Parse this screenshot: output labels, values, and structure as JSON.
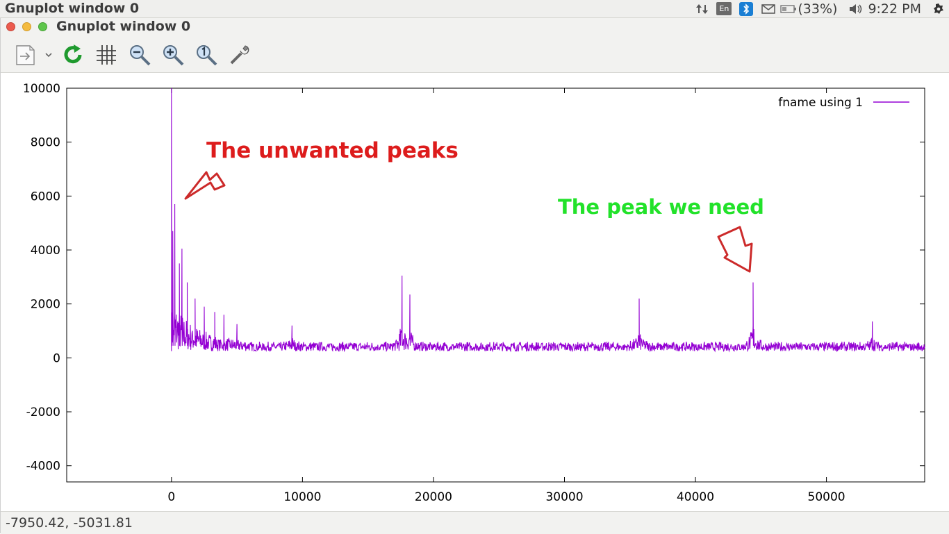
{
  "system_bar": {
    "app_title": "Gnuplot window 0",
    "keyboard_layout": "En",
    "battery_percent": "(33%)",
    "clock": "9:22 PM",
    "icons": [
      "network-icon",
      "keyboard-icon",
      "bluetooth-icon",
      "mail-icon",
      "battery-icon",
      "volume-icon",
      "gear-icon"
    ]
  },
  "window": {
    "title": "Gnuplot window 0",
    "toolbar": {
      "items": [
        "export-icon",
        "dropdown-arrow-icon",
        "replot-icon",
        "grid-icon",
        "zoom-out-icon",
        "zoom-in-icon",
        "zoom-reset-icon",
        "settings-wrench-icon"
      ]
    }
  },
  "chart_data": {
    "type": "line",
    "title": "",
    "xlabel": "",
    "ylabel": "",
    "xlim": [
      -8000,
      57500
    ],
    "ylim": [
      -4600,
      10000
    ],
    "xticks": [
      0,
      10000,
      20000,
      30000,
      40000,
      50000
    ],
    "yticks": [
      -4000,
      -2000,
      0,
      2000,
      4000,
      6000,
      8000,
      10000
    ],
    "xtick_labels": [
      "0",
      "10000",
      "20000",
      "30000",
      "40000",
      "50000"
    ],
    "ytick_labels": [
      "-4000",
      "-2000",
      "0",
      "2000",
      "4000",
      "6000",
      "8000",
      "10000"
    ],
    "legend": {
      "position": "top-right",
      "label": "fname using 1",
      "color": "#9400d3"
    },
    "series": [
      {
        "name": "fname using 1",
        "color": "#9400d3",
        "baseline_min": 250,
        "baseline_max": 600,
        "spikes": [
          {
            "x": 0,
            "y": 10000
          },
          {
            "x": 100,
            "y": 4700
          },
          {
            "x": 250,
            "y": 5700
          },
          {
            "x": 600,
            "y": 3500
          },
          {
            "x": 800,
            "y": 4050
          },
          {
            "x": 1200,
            "y": 2800
          },
          {
            "x": 1800,
            "y": 2200
          },
          {
            "x": 2500,
            "y": 1900
          },
          {
            "x": 3300,
            "y": 1700
          },
          {
            "x": 4000,
            "y": 1600
          },
          {
            "x": 5000,
            "y": 1250
          },
          {
            "x": 9200,
            "y": 1200
          },
          {
            "x": 17600,
            "y": 3050
          },
          {
            "x": 18200,
            "y": 2350
          },
          {
            "x": 35700,
            "y": 2200
          },
          {
            "x": 44400,
            "y": 2800
          },
          {
            "x": 53500,
            "y": 1350
          }
        ]
      }
    ],
    "annotations": [
      {
        "text": "The unwanted peaks",
        "color": "#dd1c1c"
      },
      {
        "text": "The peak we need",
        "color": "#22e22a"
      }
    ]
  },
  "status_bar": {
    "coordinates": "-7950.42, -5031.81"
  }
}
